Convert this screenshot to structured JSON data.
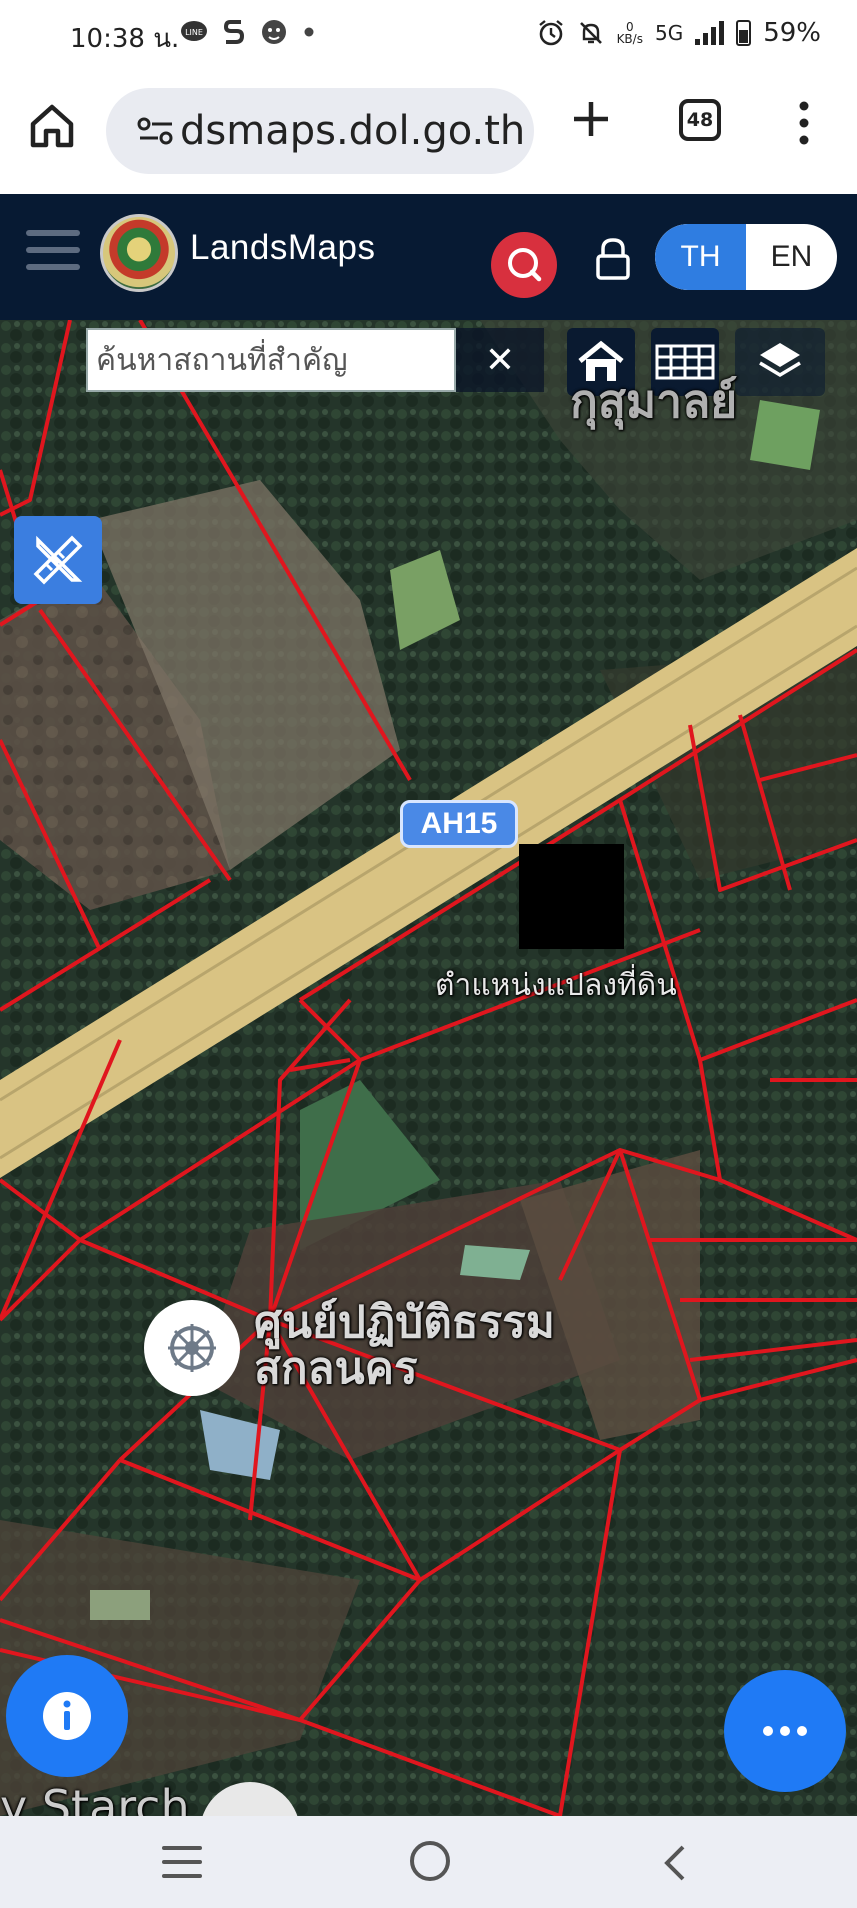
{
  "status_bar": {
    "time": "10:38 น.",
    "kbs_top": "0",
    "kbs_bottom": "KB/s",
    "network": "5G",
    "battery": "59%"
  },
  "browser": {
    "url": "dsmaps.dol.go.th",
    "tab_count": "48"
  },
  "header": {
    "brand": "LandsMaps",
    "lang_th": "TH",
    "lang_en": "EN",
    "active_lang": "TH"
  },
  "map": {
    "search_placeholder": "ค้นหาสถานที่สำคัญ",
    "clear_symbol": "✕",
    "road_label": "AH15",
    "parcel_label": "ตำแหน่งแปลงที่ดิน",
    "poi_line1": "ศูนย์ปฏิบัติธรรม",
    "poi_line2": "สกลนคร",
    "temple_label": "กุสุมาลย์",
    "starch_label": "y Starch"
  },
  "colors": {
    "header_bg": "#071a33",
    "accent_blue": "#1f7af5",
    "search_red": "#d8303e",
    "parcel_line": "#e0161e",
    "road": "#d9c383"
  }
}
